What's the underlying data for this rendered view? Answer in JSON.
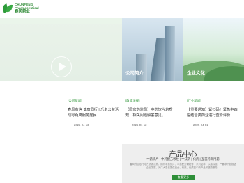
{
  "header": {
    "logo_en_1": "CHUNFENG",
    "logo_en_2": "Pharmaceutical",
    "logo_cn": "春风药业"
  },
  "tiles": {
    "company_label": "公司简介",
    "culture_label": "企业文化"
  },
  "news": [
    {
      "tag": "[公司新闻]",
      "title": "春风有信  健康同行 | 乐老公益活动零距离服务居民",
      "date": "2025-04-13"
    },
    {
      "tag": "[政策法规]",
      "title": "【国家药监局】中药饮片炮质规，相关问题解答意见。",
      "date": "2025-01-12"
    },
    {
      "tag": "[行业新闻]",
      "title": "【重要通知】紧扫码！紧急中西医结合类药业进行查阶评价...",
      "date": "2025-04-01"
    }
  ],
  "products": {
    "title": "产品中心",
    "nav": "中药饮片 | 中药配方颗粒 | 中成药 | 化药 | 互首药商用药",
    "desc": "春风药业依托地方资源优势，拥有中药饮片、中药配方颗粒等一系列品种，以高标准、严要求不断推进企业发展，为广大患者提供安全、有效、优质的中药产品和健康服务。",
    "button": "查看更多"
  },
  "colors": {
    "brand_green": "#2e8f38",
    "accent_green": "#3a9b43"
  }
}
